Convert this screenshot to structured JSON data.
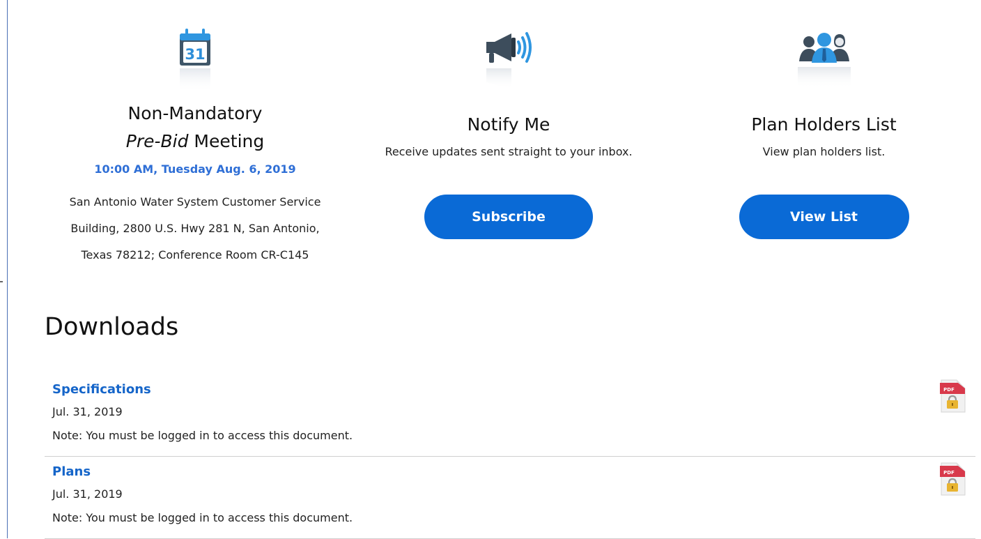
{
  "meeting": {
    "title_line1": "Non-Mandatory",
    "title_italic": "Pre-Bid",
    "title_rest": " Meeting",
    "time": "10:00 AM, Tuesday Aug. 6, 2019",
    "address_lines": [
      "San Antonio Water System Customer Service",
      "Building, 2800 U.S. Hwy 281 N, San Antonio,",
      "Texas 78212; Conference Room CR-C145"
    ],
    "calendar_day": "31",
    "icon": "calendar-icon"
  },
  "notify": {
    "title": "Notify Me",
    "subtitle": "Receive updates sent straight to your inbox.",
    "button_label": "Subscribe",
    "icon": "megaphone-icon"
  },
  "plan_holders": {
    "title": "Plan Holders List",
    "subtitle": "View plan holders list.",
    "button_label": "View List",
    "icon": "people-icon"
  },
  "downloads": {
    "heading": "Downloads",
    "items": [
      {
        "name": "Specifications",
        "date": "Jul. 31, 2019",
        "note": "Note: You must be logged in to access this document.",
        "icon": "locked-pdf-icon"
      },
      {
        "name": "Plans",
        "date": "Jul. 31, 2019",
        "note": "Note: You must be logged in to access this document.",
        "icon": "locked-pdf-icon"
      }
    ]
  },
  "colors": {
    "accent_blue": "#0a6ad6",
    "link_blue": "#1565c9",
    "time_blue": "#2f6fd6",
    "icon_blue": "#2b8fd9",
    "pdf_red": "#d8394b"
  }
}
